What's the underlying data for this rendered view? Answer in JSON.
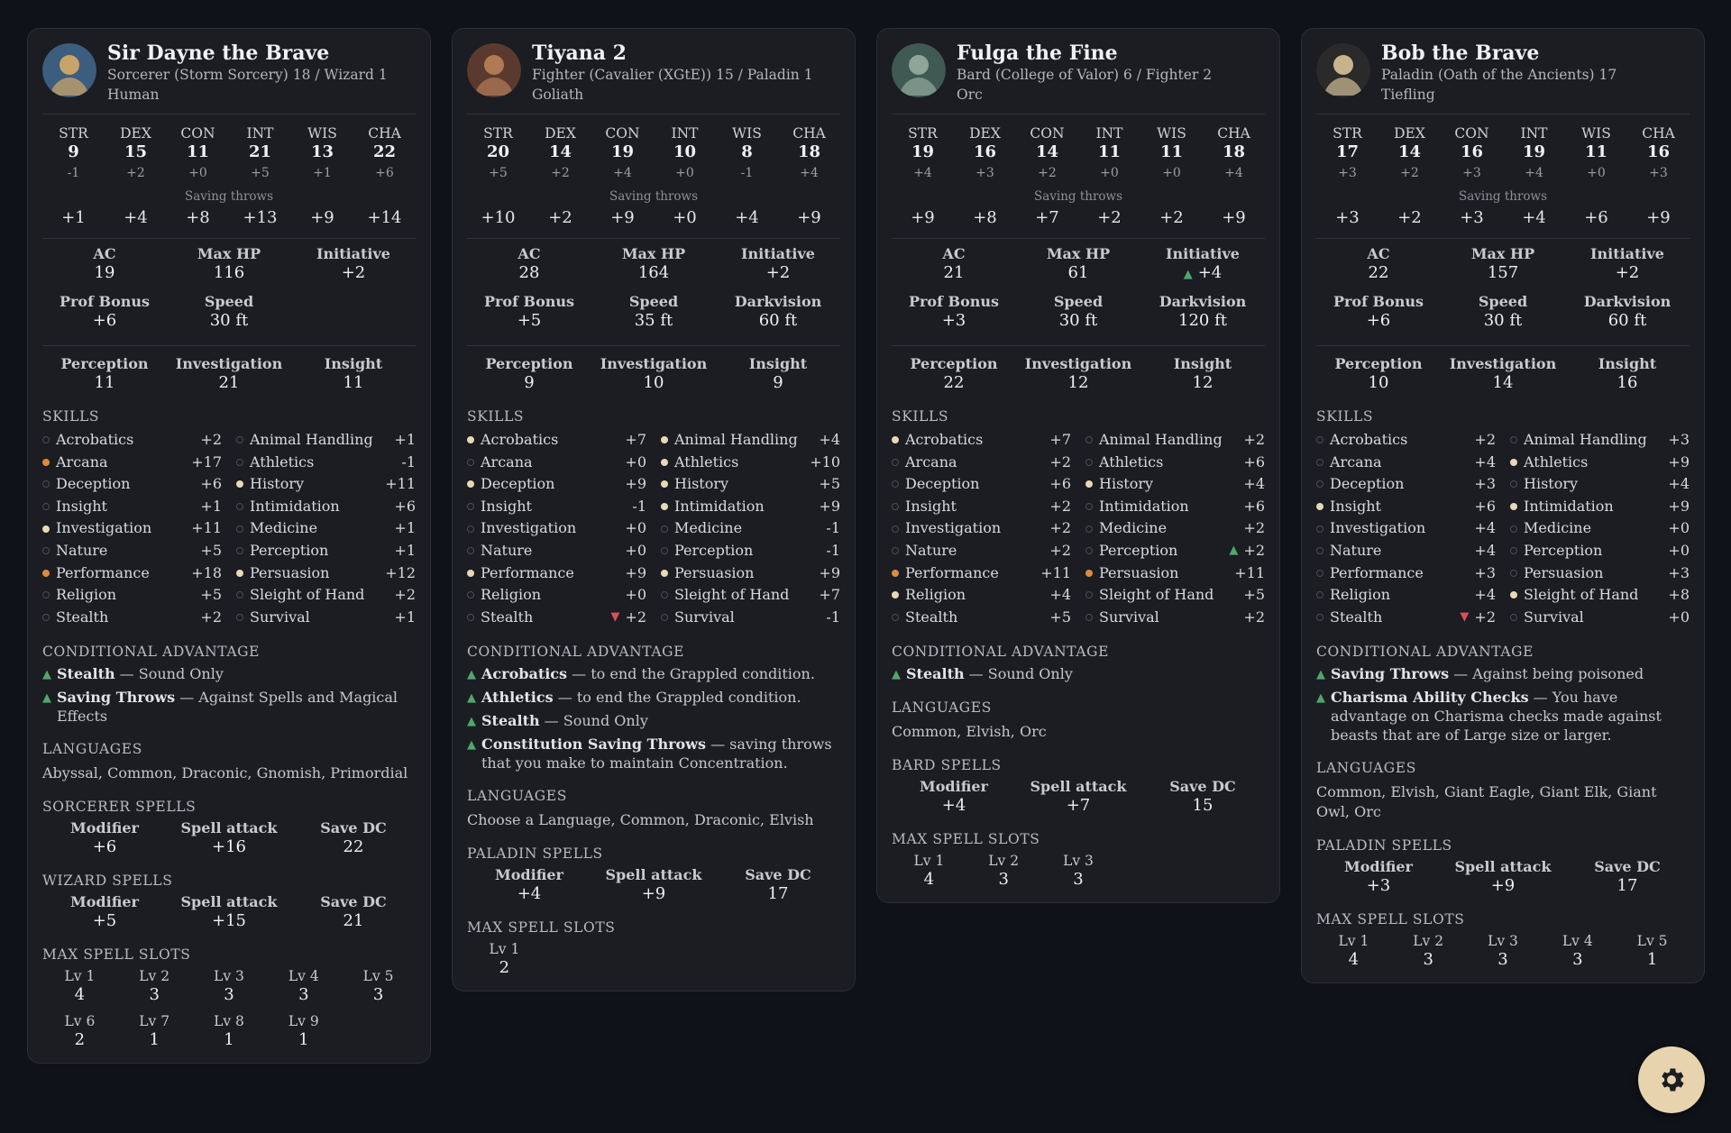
{
  "labels": {
    "abilities": [
      "STR",
      "DEX",
      "CON",
      "INT",
      "WIS",
      "CHA"
    ],
    "saving_throws": "Saving throws",
    "skills": "SKILLS",
    "conditional_advantage": "CONDITIONAL ADVANTAGE",
    "languages": "LANGUAGES",
    "max_spell_slots": "MAX SPELL SLOTS",
    "spell_cols": [
      "Modifier",
      "Spell attack",
      "Save DC"
    ],
    "passives": [
      "Perception",
      "Investigation",
      "Insight"
    ]
  },
  "settings": {
    "icon": "gear-icon"
  },
  "characters": [
    {
      "name": "Sir Dayne the Brave",
      "class_line": "Sorcerer (Storm Sorcery) 18 / Wizard 1",
      "race": "Human",
      "scores": [
        "9",
        "15",
        "11",
        "21",
        "13",
        "22"
      ],
      "mods": [
        "-1",
        "+2",
        "+0",
        "+5",
        "+1",
        "+6"
      ],
      "saves": [
        "+1",
        "+4",
        "+8",
        "+13",
        "+9",
        "+14"
      ],
      "stats": [
        {
          "k": "AC",
          "v": "19"
        },
        {
          "k": "Max HP",
          "v": "116"
        },
        {
          "k": "Initiative",
          "v": "+2"
        },
        {
          "k": "Prof Bonus",
          "v": "+6"
        },
        {
          "k": "Speed",
          "v": "30 ft"
        }
      ],
      "passives": [
        "11",
        "21",
        "11"
      ],
      "skills": [
        {
          "n": "Acrobatics",
          "v": "+2",
          "p": ""
        },
        {
          "n": "Animal Handling",
          "v": "+1",
          "p": ""
        },
        {
          "n": "Arcana",
          "v": "+17",
          "p": "e"
        },
        {
          "n": "Athletics",
          "v": "-1",
          "p": ""
        },
        {
          "n": "Deception",
          "v": "+6",
          "p": ""
        },
        {
          "n": "History",
          "v": "+11",
          "p": "p"
        },
        {
          "n": "Insight",
          "v": "+1",
          "p": ""
        },
        {
          "n": "Intimidation",
          "v": "+6",
          "p": ""
        },
        {
          "n": "Investigation",
          "v": "+11",
          "p": "p"
        },
        {
          "n": "Medicine",
          "v": "+1",
          "p": ""
        },
        {
          "n": "Nature",
          "v": "+5",
          "p": ""
        },
        {
          "n": "Perception",
          "v": "+1",
          "p": ""
        },
        {
          "n": "Performance",
          "v": "+18",
          "p": "e"
        },
        {
          "n": "Persuasion",
          "v": "+12",
          "p": "p"
        },
        {
          "n": "Religion",
          "v": "+5",
          "p": ""
        },
        {
          "n": "Sleight of Hand",
          "v": "+2",
          "p": ""
        },
        {
          "n": "Stealth",
          "v": "+2",
          "p": ""
        },
        {
          "n": "Survival",
          "v": "+1",
          "p": ""
        }
      ],
      "cond_adv": [
        {
          "b": "Stealth",
          "t": " — Sound Only"
        },
        {
          "b": "Saving Throws",
          "t": " — Against Spells and Magical Effects"
        }
      ],
      "languages": "Abyssal, Common, Draconic, Gnomish, Primordial",
      "spellcasting": [
        {
          "title": "SORCERER SPELLS",
          "vals": [
            "+6",
            "+16",
            "22"
          ]
        },
        {
          "title": "WIZARD SPELLS",
          "vals": [
            "+5",
            "+15",
            "21"
          ]
        }
      ],
      "slots": [
        {
          "k": "Lv 1",
          "v": "4"
        },
        {
          "k": "Lv 2",
          "v": "3"
        },
        {
          "k": "Lv 3",
          "v": "3"
        },
        {
          "k": "Lv 4",
          "v": "3"
        },
        {
          "k": "Lv 5",
          "v": "3"
        },
        {
          "k": "Lv 6",
          "v": "2"
        },
        {
          "k": "Lv 7",
          "v": "1"
        },
        {
          "k": "Lv 8",
          "v": "1"
        },
        {
          "k": "Lv 9",
          "v": "1"
        }
      ],
      "avatar_colors": [
        "#3d5d7e",
        "#c9a46a"
      ]
    },
    {
      "name": "Tiyana 2",
      "class_line": "Fighter (Cavalier (XGtE)) 15 / Paladin 1",
      "race": "Goliath",
      "scores": [
        "20",
        "14",
        "19",
        "10",
        "8",
        "18"
      ],
      "mods": [
        "+5",
        "+2",
        "+4",
        "+0",
        "-1",
        "+4"
      ],
      "saves": [
        "+10",
        "+2",
        "+9",
        "+0",
        "+4",
        "+9"
      ],
      "stats": [
        {
          "k": "AC",
          "v": "28"
        },
        {
          "k": "Max HP",
          "v": "164"
        },
        {
          "k": "Initiative",
          "v": "+2"
        },
        {
          "k": "Prof Bonus",
          "v": "+5"
        },
        {
          "k": "Speed",
          "v": "35 ft"
        },
        {
          "k": "Darkvision",
          "v": "60 ft"
        }
      ],
      "passives": [
        "9",
        "10",
        "9"
      ],
      "skills": [
        {
          "n": "Acrobatics",
          "v": "+7",
          "p": "p"
        },
        {
          "n": "Animal Handling",
          "v": "+4",
          "p": "p"
        },
        {
          "n": "Arcana",
          "v": "+0",
          "p": ""
        },
        {
          "n": "Athletics",
          "v": "+10",
          "p": "p"
        },
        {
          "n": "Deception",
          "v": "+9",
          "p": "p"
        },
        {
          "n": "History",
          "v": "+5",
          "p": "p"
        },
        {
          "n": "Insight",
          "v": "-1",
          "p": ""
        },
        {
          "n": "Intimidation",
          "v": "+9",
          "p": "p"
        },
        {
          "n": "Investigation",
          "v": "+0",
          "p": ""
        },
        {
          "n": "Medicine",
          "v": "-1",
          "p": ""
        },
        {
          "n": "Nature",
          "v": "+0",
          "p": ""
        },
        {
          "n": "Perception",
          "v": "-1",
          "p": ""
        },
        {
          "n": "Performance",
          "v": "+9",
          "p": "p"
        },
        {
          "n": "Persuasion",
          "v": "+9",
          "p": "p"
        },
        {
          "n": "Religion",
          "v": "+0",
          "p": ""
        },
        {
          "n": "Sleight of Hand",
          "v": "+7",
          "p": ""
        },
        {
          "n": "Stealth",
          "v": "+2",
          "p": "",
          "dis": true
        },
        {
          "n": "Survival",
          "v": "-1",
          "p": ""
        }
      ],
      "cond_adv": [
        {
          "b": "Acrobatics",
          "t": " — to end the Grappled condition."
        },
        {
          "b": "Athletics",
          "t": " — to end the Grappled condition."
        },
        {
          "b": "Stealth",
          "t": " — Sound Only"
        },
        {
          "b": "Constitution Saving Throws",
          "t": " — saving throws that you make to maintain Concentration."
        }
      ],
      "languages": "Choose a Language, Common, Draconic, Elvish",
      "spellcasting": [
        {
          "title": "PALADIN SPELLS",
          "vals": [
            "+4",
            "+9",
            "17"
          ]
        }
      ],
      "slots": [
        {
          "k": "Lv 1",
          "v": "2"
        }
      ],
      "avatar_colors": [
        "#5a3a2e",
        "#b07a55"
      ]
    },
    {
      "name": "Fulga the Fine",
      "class_line": "Bard (College of Valor) 6 / Fighter 2",
      "race": "Orc",
      "scores": [
        "19",
        "16",
        "14",
        "11",
        "11",
        "18"
      ],
      "mods": [
        "+4",
        "+3",
        "+2",
        "+0",
        "+0",
        "+4"
      ],
      "saves": [
        "+9",
        "+8",
        "+7",
        "+2",
        "+2",
        "+9"
      ],
      "stats": [
        {
          "k": "AC",
          "v": "21"
        },
        {
          "k": "Max HP",
          "v": "61"
        },
        {
          "k": "Initiative",
          "v": "+4",
          "adv": true
        },
        {
          "k": "Prof Bonus",
          "v": "+3"
        },
        {
          "k": "Speed",
          "v": "30 ft"
        },
        {
          "k": "Darkvision",
          "v": "120 ft"
        }
      ],
      "passives": [
        "22",
        "12",
        "12"
      ],
      "skills": [
        {
          "n": "Acrobatics",
          "v": "+7",
          "p": "p"
        },
        {
          "n": "Animal Handling",
          "v": "+2",
          "p": ""
        },
        {
          "n": "Arcana",
          "v": "+2",
          "p": ""
        },
        {
          "n": "Athletics",
          "v": "+6",
          "p": ""
        },
        {
          "n": "Deception",
          "v": "+6",
          "p": ""
        },
        {
          "n": "History",
          "v": "+4",
          "p": "p"
        },
        {
          "n": "Insight",
          "v": "+2",
          "p": ""
        },
        {
          "n": "Intimidation",
          "v": "+6",
          "p": ""
        },
        {
          "n": "Investigation",
          "v": "+2",
          "p": ""
        },
        {
          "n": "Medicine",
          "v": "+2",
          "p": ""
        },
        {
          "n": "Nature",
          "v": "+2",
          "p": ""
        },
        {
          "n": "Perception",
          "v": "+2",
          "p": "",
          "adv": true
        },
        {
          "n": "Performance",
          "v": "+11",
          "p": "e"
        },
        {
          "n": "Persuasion",
          "v": "+11",
          "p": "e"
        },
        {
          "n": "Religion",
          "v": "+4",
          "p": "p"
        },
        {
          "n": "Sleight of Hand",
          "v": "+5",
          "p": ""
        },
        {
          "n": "Stealth",
          "v": "+5",
          "p": ""
        },
        {
          "n": "Survival",
          "v": "+2",
          "p": ""
        }
      ],
      "cond_adv": [
        {
          "b": "Stealth",
          "t": " — Sound Only"
        }
      ],
      "languages": "Common, Elvish, Orc",
      "spellcasting": [
        {
          "title": "BARD SPELLS",
          "vals": [
            "+4",
            "+7",
            "15"
          ]
        }
      ],
      "slots": [
        {
          "k": "Lv 1",
          "v": "4"
        },
        {
          "k": "Lv 2",
          "v": "3"
        },
        {
          "k": "Lv 3",
          "v": "3"
        }
      ],
      "avatar_colors": [
        "#3f5a52",
        "#8fa59a"
      ]
    },
    {
      "name": "Bob the Brave",
      "class_line": "Paladin (Oath of the Ancients) 17",
      "race": "Tiefling",
      "scores": [
        "17",
        "14",
        "16",
        "19",
        "11",
        "16"
      ],
      "mods": [
        "+3",
        "+2",
        "+3",
        "+4",
        "+0",
        "+3"
      ],
      "saves": [
        "+3",
        "+2",
        "+3",
        "+4",
        "+6",
        "+9"
      ],
      "stats": [
        {
          "k": "AC",
          "v": "22"
        },
        {
          "k": "Max HP",
          "v": "157"
        },
        {
          "k": "Initiative",
          "v": "+2"
        },
        {
          "k": "Prof Bonus",
          "v": "+6"
        },
        {
          "k": "Speed",
          "v": "30 ft"
        },
        {
          "k": "Darkvision",
          "v": "60 ft"
        }
      ],
      "passives": [
        "10",
        "14",
        "16"
      ],
      "skills": [
        {
          "n": "Acrobatics",
          "v": "+2",
          "p": ""
        },
        {
          "n": "Animal Handling",
          "v": "+3",
          "p": ""
        },
        {
          "n": "Arcana",
          "v": "+4",
          "p": ""
        },
        {
          "n": "Athletics",
          "v": "+9",
          "p": "p"
        },
        {
          "n": "Deception",
          "v": "+3",
          "p": ""
        },
        {
          "n": "History",
          "v": "+4",
          "p": ""
        },
        {
          "n": "Insight",
          "v": "+6",
          "p": "p"
        },
        {
          "n": "Intimidation",
          "v": "+9",
          "p": "p"
        },
        {
          "n": "Investigation",
          "v": "+4",
          "p": ""
        },
        {
          "n": "Medicine",
          "v": "+0",
          "p": ""
        },
        {
          "n": "Nature",
          "v": "+4",
          "p": ""
        },
        {
          "n": "Perception",
          "v": "+0",
          "p": ""
        },
        {
          "n": "Performance",
          "v": "+3",
          "p": ""
        },
        {
          "n": "Persuasion",
          "v": "+3",
          "p": ""
        },
        {
          "n": "Religion",
          "v": "+4",
          "p": ""
        },
        {
          "n": "Sleight of Hand",
          "v": "+8",
          "p": "p"
        },
        {
          "n": "Stealth",
          "v": "+2",
          "p": "",
          "dis": true
        },
        {
          "n": "Survival",
          "v": "+0",
          "p": ""
        }
      ],
      "cond_adv": [
        {
          "b": "Saving Throws",
          "t": " — Against being poisoned"
        },
        {
          "b": "Charisma Ability Checks",
          "t": " — You have advantage on Charisma checks made against beasts that are of Large size or larger."
        }
      ],
      "languages": "Common, Elvish, Giant Eagle, Giant Elk, Giant Owl, Orc",
      "spellcasting": [
        {
          "title": "PALADIN SPELLS",
          "vals": [
            "+3",
            "+9",
            "17"
          ]
        }
      ],
      "slots": [
        {
          "k": "Lv 1",
          "v": "4"
        },
        {
          "k": "Lv 2",
          "v": "3"
        },
        {
          "k": "Lv 3",
          "v": "3"
        },
        {
          "k": "Lv 4",
          "v": "3"
        },
        {
          "k": "Lv 5",
          "v": "1"
        }
      ],
      "avatar_colors": [
        "#2a2a2a",
        "#c7b48c"
      ]
    }
  ]
}
